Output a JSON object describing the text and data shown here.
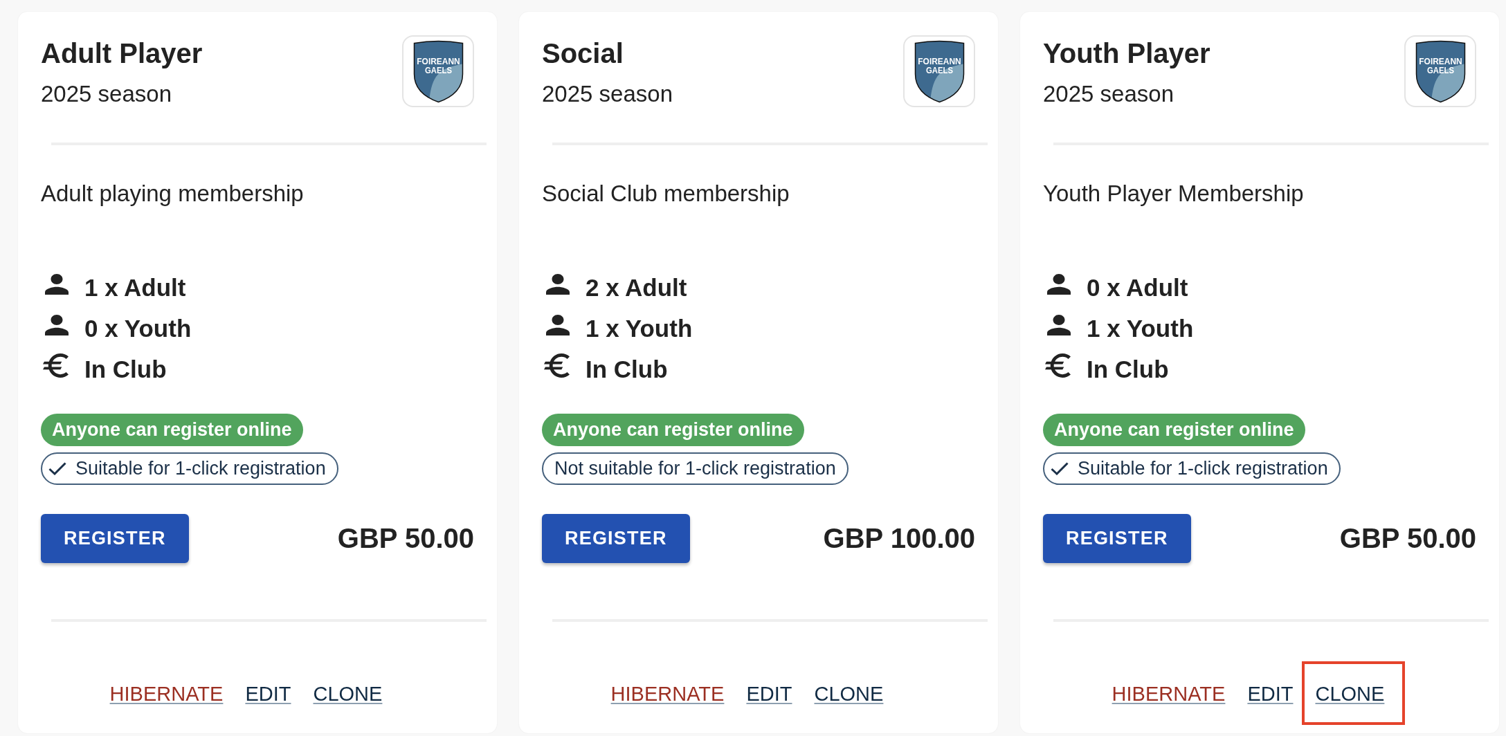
{
  "cards": [
    {
      "title": "Adult Player",
      "subtitle": "2025 season",
      "logo": [
        "FOIREANN",
        "GAELS"
      ],
      "description": "Adult playing membership",
      "features": [
        {
          "kind": "person",
          "label": "1 x Adult"
        },
        {
          "kind": "person",
          "label": "0 x Youth"
        },
        {
          "kind": "euro",
          "label": "In Club"
        }
      ],
      "registration_badge": "Anyone can register online",
      "one_click_badge": {
        "label": "Suitable for 1-click registration",
        "checked": true
      },
      "button": "REGISTER",
      "price": "GBP 50.00",
      "links": [
        {
          "label": "HIBERNATE",
          "kind": "danger",
          "highlighted": false
        },
        {
          "label": "EDIT",
          "kind": "default",
          "highlighted": false
        },
        {
          "label": "CLONE",
          "kind": "default",
          "highlighted": false
        }
      ]
    },
    {
      "title": "Social",
      "subtitle": "2025 season",
      "logo": [
        "FOIREANN",
        "GAELS"
      ],
      "description": "Social Club membership",
      "features": [
        {
          "kind": "person",
          "label": "2 x Adult"
        },
        {
          "kind": "person",
          "label": "1 x Youth"
        },
        {
          "kind": "euro",
          "label": "In Club"
        }
      ],
      "registration_badge": "Anyone can register online",
      "one_click_badge": {
        "label": "Not suitable for 1-click registration",
        "checked": false
      },
      "button": "REGISTER",
      "price": "GBP 100.00",
      "links": [
        {
          "label": "HIBERNATE",
          "kind": "danger",
          "highlighted": false
        },
        {
          "label": "EDIT",
          "kind": "default",
          "highlighted": false
        },
        {
          "label": "CLONE",
          "kind": "default",
          "highlighted": false
        }
      ]
    },
    {
      "title": "Youth Player",
      "subtitle": "2025 season",
      "logo": [
        "FOIREANN",
        "GAELS"
      ],
      "description": "Youth Player Membership",
      "features": [
        {
          "kind": "person",
          "label": "0 x Adult"
        },
        {
          "kind": "person",
          "label": "1 x Youth"
        },
        {
          "kind": "euro",
          "label": "In Club"
        }
      ],
      "registration_badge": "Anyone can register online",
      "one_click_badge": {
        "label": "Suitable for 1-click registration",
        "checked": true
      },
      "button": "REGISTER",
      "price": "GBP 50.00",
      "links": [
        {
          "label": "HIBERNATE",
          "kind": "danger",
          "highlighted": false
        },
        {
          "label": "EDIT",
          "kind": "default",
          "highlighted": false
        },
        {
          "label": "CLONE",
          "kind": "default",
          "highlighted": true
        }
      ]
    }
  ]
}
